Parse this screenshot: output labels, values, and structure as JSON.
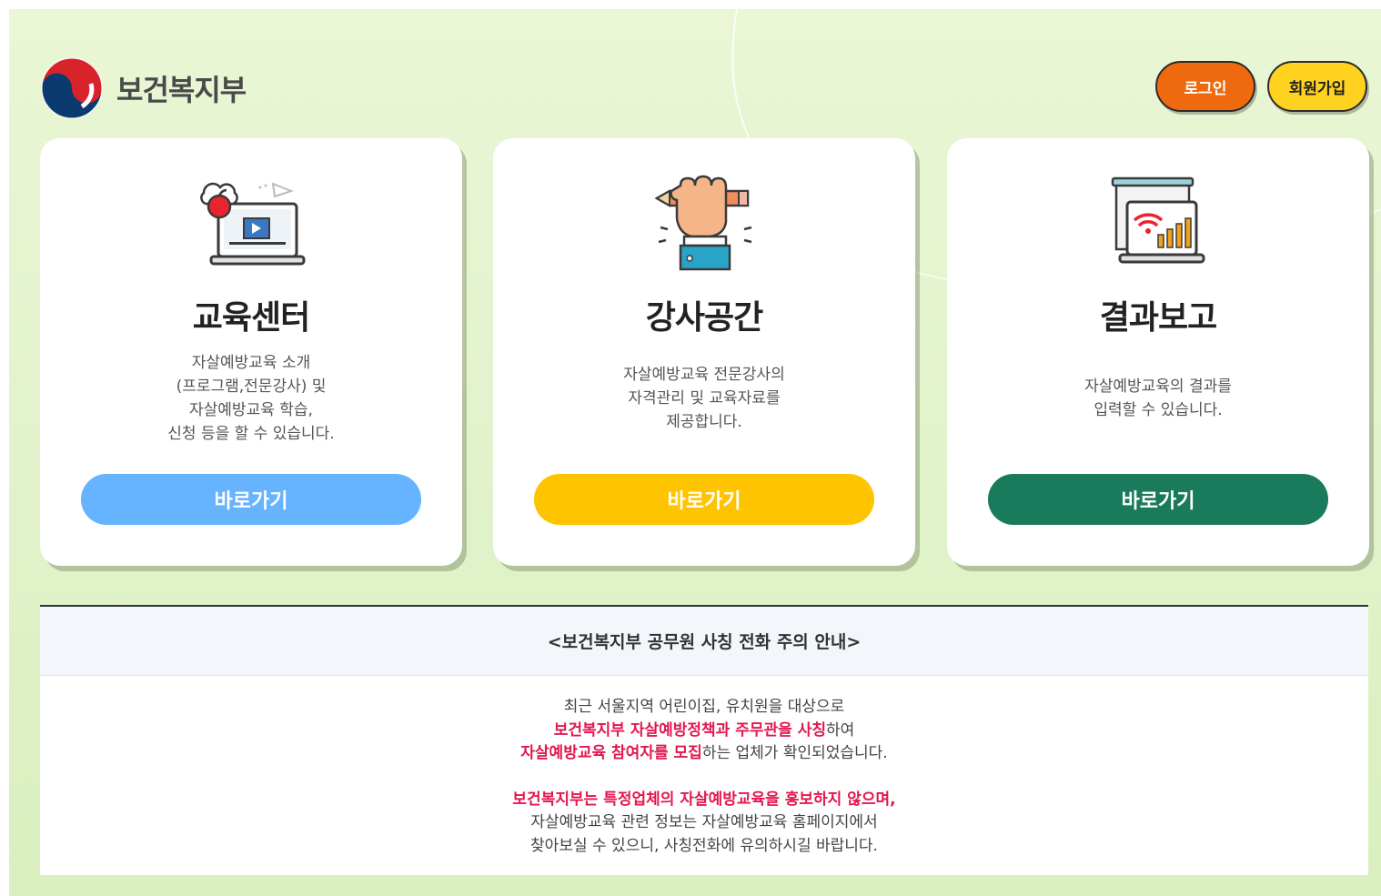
{
  "header": {
    "logo_text": "보건복지부",
    "login_label": "로그인",
    "join_label": "회원가입"
  },
  "cards": [
    {
      "title": "교육센터",
      "desc": "자살예방교육 소개\n(프로그램,전문강사) 및\n자살예방교육 학습,\n신청 등을 할 수 있습니다.",
      "button": "바로가기",
      "button_color": "#66b3ff",
      "icon": "laptop-video-icon"
    },
    {
      "title": "강사공간",
      "desc": "자살예방교육 전문강사의\n자격관리 및 교육자료를\n제공합니다.",
      "button": "바로가기",
      "button_color": "#ffc400",
      "icon": "hand-pencil-icon"
    },
    {
      "title": "결과보고",
      "desc": "자살예방교육의 결과를\n입력할 수 있습니다.",
      "button": "바로가기",
      "button_color": "#1a7a5c",
      "icon": "report-chart-icon"
    }
  ],
  "notice": {
    "title": "<보건복지부 공무원 사칭 전화 주의 안내>",
    "line1": "최근 서울지역 어린이집, 유치원을 대상으로",
    "line2_red": "보건복지부 자살예방정책과 주무관을 사칭",
    "line2_rest": "하여",
    "line3_red": "자살예방교육 참여자를 모집",
    "line3_rest": "하는 업체가 확인되었습니다.",
    "line4_red": "보건복지부는 특정업체의 자살예방교육을 홍보하지 않으며,",
    "line5": "자살예방교육 관련 정보는 자살예방교육 홈페이지에서",
    "line6": "찾아보실 수 있으니, 사칭전화에 유의하시길 바랍니다."
  },
  "colors": {
    "login": "#ef6a0f",
    "join": "#ffd21f",
    "notice_red": "#e2174f"
  }
}
